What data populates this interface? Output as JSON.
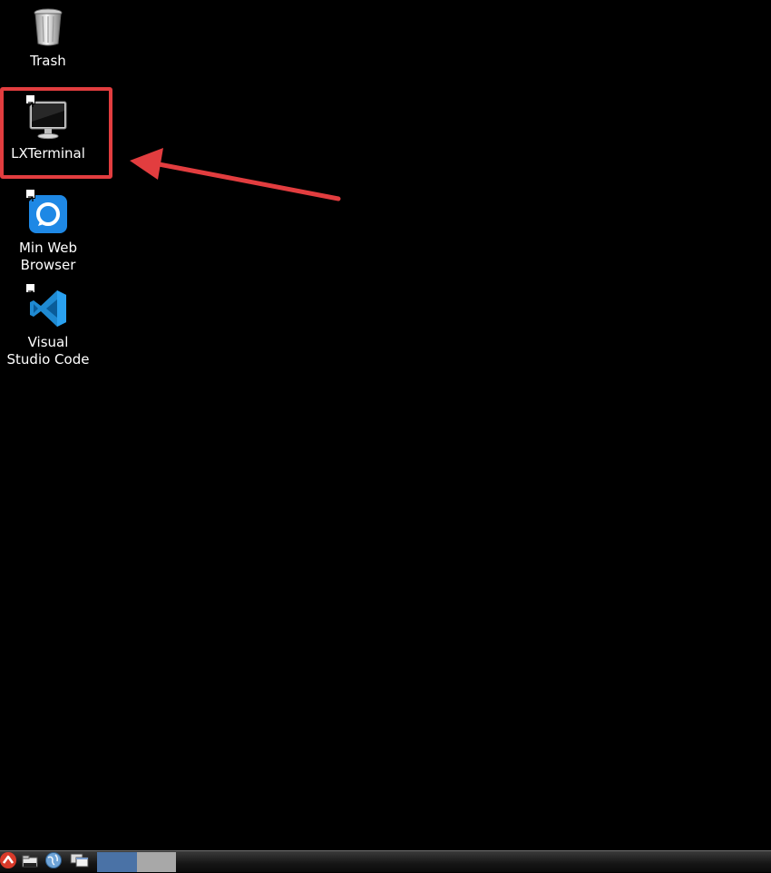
{
  "desktop": {
    "icons": [
      {
        "label": "Trash",
        "icon": "trash-can-icon"
      },
      {
        "label": "LXTerminal",
        "icon": "monitor-icon"
      },
      {
        "label": "Min Web\nBrowser",
        "icon": "min-browser-icon"
      },
      {
        "label": "Visual\nStudio Code",
        "icon": "vscode-icon"
      }
    ]
  },
  "annotation": {
    "highlight_color": "#e23d3f",
    "target": "LXTerminal"
  },
  "taskbar": {
    "items": [
      {
        "icon": "app-menu-icon"
      },
      {
        "icon": "file-manager-icon"
      },
      {
        "icon": "web-browser-icon"
      },
      {
        "icon": "window-switcher-icon"
      }
    ],
    "desktop_pager": [
      {
        "state": "active",
        "color": "#4a72a6"
      },
      {
        "state": "inactive",
        "color": "#a8a8a8"
      }
    ]
  }
}
